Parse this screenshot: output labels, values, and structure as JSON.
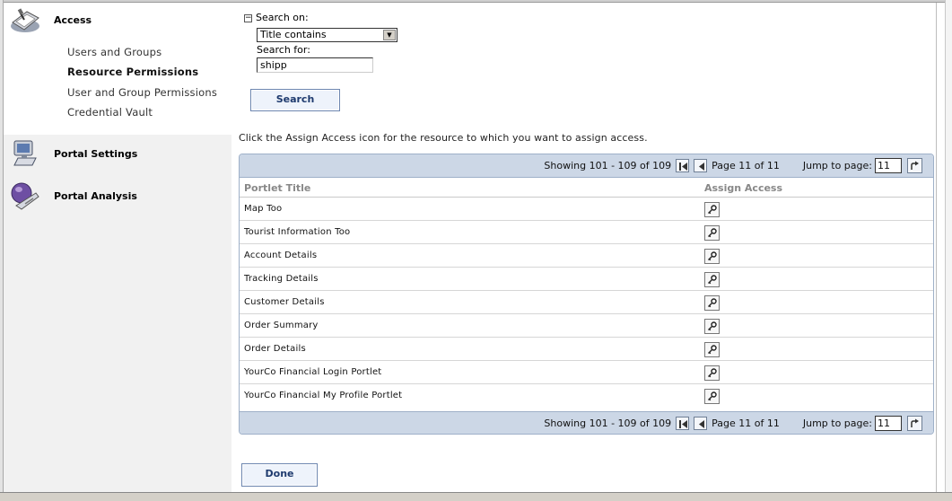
{
  "sidebar": {
    "sections": [
      {
        "label": "Access",
        "icon": "access-book-icon"
      },
      {
        "label": "Portal Settings",
        "icon": "portal-settings-computer-icon"
      },
      {
        "label": "Portal Analysis",
        "icon": "portal-analysis-globe-icon"
      }
    ],
    "access_links": [
      "Users and Groups",
      "Resource Permissions",
      "User and Group Permissions",
      "Credential Vault"
    ],
    "current_link": "Resource Permissions"
  },
  "search": {
    "toggle_symbol": "⊟",
    "search_on_label": "Search on:",
    "search_on_value": "Title contains",
    "search_for_label": "Search for:",
    "search_for_value": "shipp",
    "search_button": "Search"
  },
  "instructions": "Click the Assign Access icon for the resource to which you want to assign access.",
  "pager": {
    "showing": "Showing 101 - 109 of 109",
    "page": "Page 11 of 11",
    "jump_label": "Jump to page:",
    "jump_value": "11"
  },
  "table": {
    "headers": [
      "Portlet Title",
      "Assign Access"
    ],
    "rows": [
      "Map Too",
      "Tourist Information Too",
      "Account Details",
      "Tracking Details",
      "Customer Details",
      "Order Summary",
      "Order Details",
      "YourCo Financial Login Portlet",
      "YourCo Financial My Profile Portlet"
    ]
  },
  "done_button": "Done",
  "colors": {
    "pager_bg": "#ccd7e6",
    "button_text": "#1e3a6e",
    "sidebar_bg": "#f1f1f1"
  }
}
